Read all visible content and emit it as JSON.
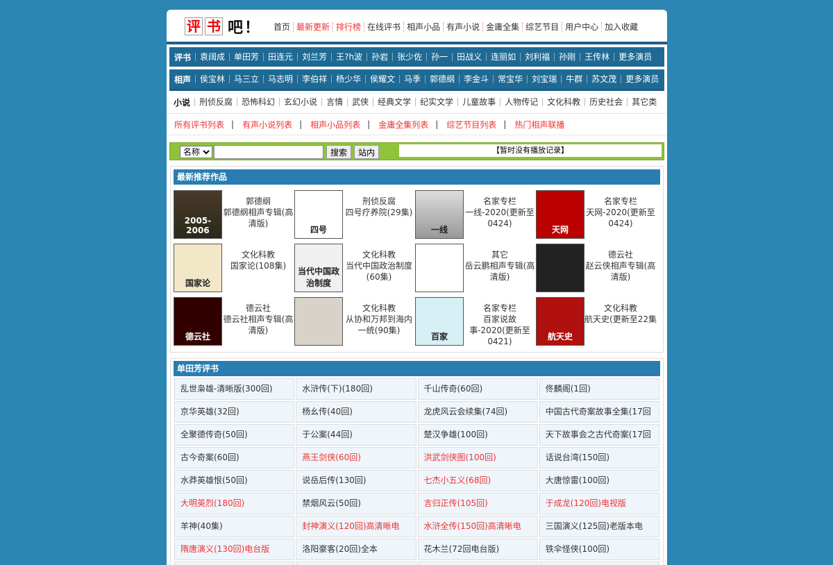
{
  "logo": {
    "chars": [
      "评",
      "书"
    ],
    "ba": "吧",
    "ex": "！"
  },
  "topnav": [
    {
      "label": "首页",
      "red": false
    },
    {
      "label": "最新更新",
      "red": true
    },
    {
      "label": "排行榜",
      "red": true
    },
    {
      "label": "在线评书",
      "red": false
    },
    {
      "label": "相声小品",
      "red": false
    },
    {
      "label": "有声小说",
      "red": false
    },
    {
      "label": "金庸全集",
      "red": false
    },
    {
      "label": "综艺节目",
      "red": false
    },
    {
      "label": "用户中心",
      "red": false
    },
    {
      "label": "加入收藏",
      "red": false
    }
  ],
  "pingshu_bar": {
    "heading": "评书",
    "items": [
      "袁阔成",
      "单田芳",
      "田连元",
      "刘兰芳",
      "王?h波",
      "孙岩",
      "张少佐",
      "孙一",
      "田战义",
      "连丽如",
      "刘利福",
      "孙刚",
      "王传林",
      "更多演员"
    ]
  },
  "xiangsheng_bar": {
    "heading": "相声",
    "items": [
      "侯宝林",
      "马三立",
      "马志明",
      "李伯祥",
      "杨少华",
      "侯耀文",
      "马季",
      "郭德纲",
      "李金斗",
      "常宝华",
      "刘宝瑞",
      "牛群",
      "苏文茂",
      "更多演员"
    ]
  },
  "novel_bar": {
    "heading": "小说",
    "items": [
      "刑侦反腐",
      "恐怖科幻",
      "玄幻小说",
      "言情",
      "武侠",
      "经典文学",
      "纪实文学",
      "儿童故事",
      "人物传记",
      "文化科教",
      "历史社会",
      "其它类"
    ]
  },
  "list_links": [
    "所有评书列表",
    "有声小说列表",
    "相声小品列表",
    "金庸全集列表",
    "综艺节目列表",
    "热门相声联播"
  ],
  "search": {
    "select_value": "名称",
    "input_value": "",
    "search_button": "搜索",
    "site_button": "站内",
    "record_text": "【暂时没有播放记录】"
  },
  "recommend": {
    "title": "最新推荐作品",
    "cards": [
      {
        "cat": "郭德纲",
        "title": "郭德纲相声专辑(高清版)",
        "thumb": "t1",
        "thumb_text": "2005-2006"
      },
      {
        "cat": "刑侦反腐",
        "title": "四号疗养院(29集)",
        "thumb": "t2",
        "thumb_text": "四号"
      },
      {
        "cat": "名家专栏",
        "title": "一线-2020(更新至0424)",
        "thumb": "t3",
        "thumb_text": "一线"
      },
      {
        "cat": "名家专栏",
        "title": "天网-2020(更新至0424)",
        "thumb": "t4",
        "thumb_text": "天网"
      },
      {
        "cat": "文化科教",
        "title": "国家论(108集)",
        "thumb": "t5",
        "thumb_text": "国家论"
      },
      {
        "cat": "文化科教",
        "title": "当代中国政治制度(60集)",
        "thumb": "t6",
        "thumb_text": "当代中国政治制度"
      },
      {
        "cat": "其它",
        "title": "岳云鹏相声专辑(高清版)",
        "thumb": "t7",
        "thumb_text": ""
      },
      {
        "cat": "德云社",
        "title": "赵云侠相声专辑(高清版)",
        "thumb": "t8",
        "thumb_text": ""
      },
      {
        "cat": "德云社",
        "title": "德云社相声专辑(高清版)",
        "thumb": "t9",
        "thumb_text": "德云社"
      },
      {
        "cat": "文化科教",
        "title": "从协和万邦到海内一统(90集)",
        "thumb": "t10",
        "thumb_text": ""
      },
      {
        "cat": "名家专栏",
        "title": "百家说故事-2020(更新至0421)",
        "thumb": "t11",
        "thumb_text": "百家"
      },
      {
        "cat": "文化科教",
        "title": "航天史(更新至22集",
        "thumb": "t12",
        "thumb_text": "航天史"
      }
    ]
  },
  "shantianfang": {
    "title": "单田芳评书",
    "items": [
      {
        "label": "乱世枭雄-清晰版(300回)",
        "red": false
      },
      {
        "label": "水浒传(下)(180回)",
        "red": false
      },
      {
        "label": "千山传奇(60回)",
        "red": false
      },
      {
        "label": "佟麟阁(1回)",
        "red": false
      },
      {
        "label": "京华英雄(32回)",
        "red": false
      },
      {
        "label": "杨幺传(40回)",
        "red": false
      },
      {
        "label": "龙虎风云会续集(74回)",
        "red": false
      },
      {
        "label": "中国古代奇案故事全集(17回",
        "red": false
      },
      {
        "label": "全聚德传奇(50回)",
        "red": false
      },
      {
        "label": "于公案(44回)",
        "red": false
      },
      {
        "label": "楚汉争雄(100回)",
        "red": false
      },
      {
        "label": "天下故事会之古代奇案(17回",
        "red": false
      },
      {
        "label": "古今奇案(60回)",
        "red": false
      },
      {
        "label": "燕王剑侠(60回)",
        "red": true
      },
      {
        "label": "洪武剑侠图(100回)",
        "red": true
      },
      {
        "label": "话说台湾(150回)",
        "red": false
      },
      {
        "label": "水莽英雄恨(50回)",
        "red": false
      },
      {
        "label": "说岳后传(130回)",
        "red": false
      },
      {
        "label": "七杰小五义(68回)",
        "red": true
      },
      {
        "label": "大唐惊雷(100回)",
        "red": false
      },
      {
        "label": "大明英烈(180回)",
        "red": true
      },
      {
        "label": "禁烟风云(50回)",
        "red": false
      },
      {
        "label": "言归正传(105回)",
        "red": true
      },
      {
        "label": "于成龙(120回)电视版",
        "red": true
      },
      {
        "label": "羊神(40集)",
        "red": false
      },
      {
        "label": "封神演义(120回)高清晰电",
        "red": true
      },
      {
        "label": "水浒全传(150回)高清晰电",
        "red": true
      },
      {
        "label": "三国演义(125回)老版本电",
        "red": false
      },
      {
        "label": "隋唐演义(130回)电台版",
        "red": true
      },
      {
        "label": "洛阳豪客(20回)全本",
        "red": false
      },
      {
        "label": "花木兰(72回电台版)",
        "red": false
      },
      {
        "label": "铁伞怪侠(100回)",
        "red": false
      },
      {
        "label": "",
        "red": false
      },
      {
        "label": "",
        "red": false
      },
      {
        "label": "",
        "red": false
      },
      {
        "label": "",
        "red": false
      }
    ]
  }
}
